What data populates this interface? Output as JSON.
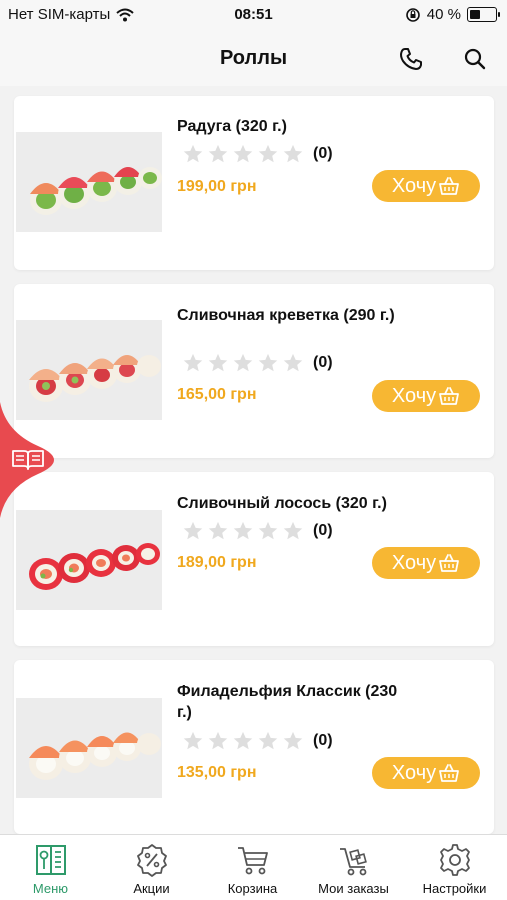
{
  "status": {
    "carrier": "Нет SIM-карты",
    "time": "08:51",
    "battery": "40 %",
    "battery_level": 0.4
  },
  "header": {
    "title": "Роллы",
    "icons": [
      "phone-icon",
      "search-icon"
    ]
  },
  "products": [
    {
      "title": "Радуга  (320 г.)",
      "rating_count": "(0)",
      "rating": 0,
      "price": "199,00 грн",
      "button": "Хочу"
    },
    {
      "title": "Сливочная креветка (290 г.)",
      "rating_count": "(0)",
      "rating": 0,
      "price": "165,00 грн",
      "button": "Хочу"
    },
    {
      "title": "Сливочный лосось (320 г.)",
      "rating_count": "(0)",
      "rating": 0,
      "price": "189,00 грн",
      "button": "Хочу"
    },
    {
      "title": "Филадельфия Классик (230 г.)",
      "rating_count": "(0)",
      "rating": 0,
      "price": "135,00 грн",
      "button": "Хочу"
    }
  ],
  "tabs": [
    {
      "label": "Меню",
      "icon": "menu-book-icon",
      "active": true
    },
    {
      "label": "Акции",
      "icon": "percent-badge-icon",
      "active": false
    },
    {
      "label": "Корзина",
      "icon": "cart-icon",
      "active": false
    },
    {
      "label": "Мои заказы",
      "icon": "orders-cart-icon",
      "active": false
    },
    {
      "label": "Настройки",
      "icon": "gear-icon",
      "active": false
    }
  ],
  "colors": {
    "accent": "#f7b733",
    "price": "#f0a81e",
    "side_tab": "#e84a4f",
    "active_tab": "#2e9a6a",
    "star_empty": "#dedede"
  }
}
